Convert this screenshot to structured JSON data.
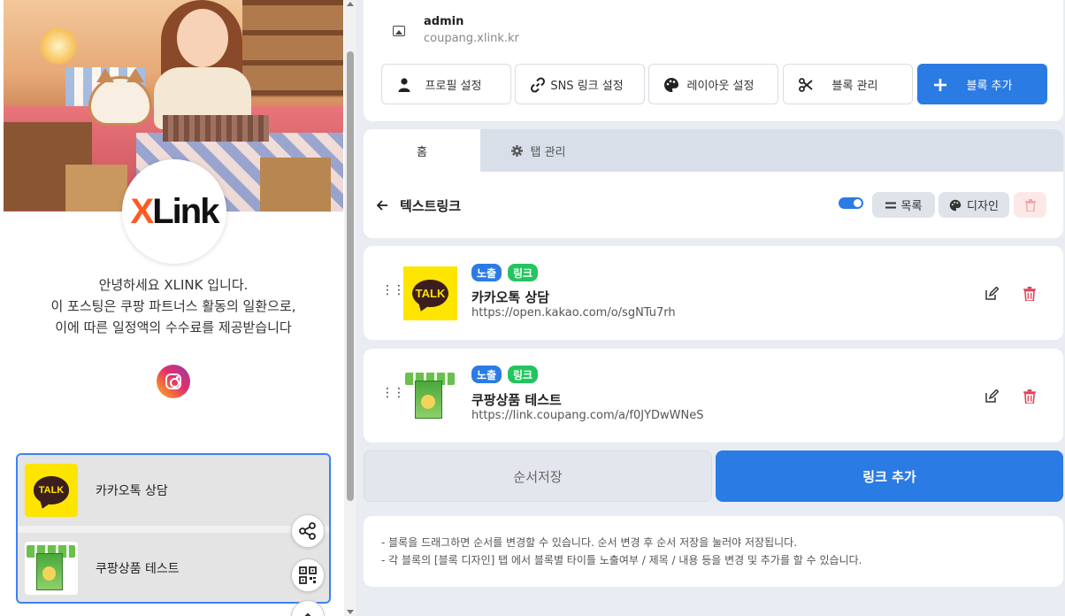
{
  "preview": {
    "logo_part1": "X",
    "logo_part2": "Link",
    "intro_lines": [
      "안녕하세요 XLINK 입니다.",
      "이 포스팅은 쿠팡 파트너스 활동의 일환으로,",
      "이에 따른 일정액의 수수료를 제공받습니다"
    ],
    "social_icon": "instagram-icon",
    "items": [
      {
        "label": "카카오톡 상담",
        "icon": "kakao-talk-icon",
        "icon_text": "TALK"
      },
      {
        "label": "쿠팡상품 테스트",
        "icon": "product-image"
      }
    ]
  },
  "header": {
    "name": "admin",
    "url": "coupang.xlink.kr",
    "buttons": [
      {
        "label": "프로필 설정",
        "icon": "user-icon"
      },
      {
        "label": "SNS 링크 설정",
        "icon": "link-icon"
      },
      {
        "label": "레이아웃 설정",
        "icon": "palette-icon"
      },
      {
        "label": "블록 관리",
        "icon": "scissors-icon"
      },
      {
        "label": "블록 추가",
        "icon": "plus-icon"
      }
    ]
  },
  "tabs": [
    {
      "label": "홈",
      "active": true
    },
    {
      "label": "탭 관리",
      "icon": "gear-icon",
      "active": false
    }
  ],
  "block_editor": {
    "title": "텍스트링크",
    "toggle_on": true,
    "list_label": "목록",
    "design_label": "디자인"
  },
  "blocks": [
    {
      "badge_visible": "노출",
      "badge_type": "링크",
      "title": "카카오톡 상담",
      "url": "https://open.kakao.com/o/sgNTu7rh",
      "icon_text": "TALK"
    },
    {
      "badge_visible": "노출",
      "badge_type": "링크",
      "title": "쿠팡상품 테스트",
      "url": "https://link.coupang.com/a/f0JYDwWNeS"
    }
  ],
  "actions": {
    "save_order": "순서저장",
    "add_link": "링크 추가"
  },
  "notes": [
    "- 블록을 드래그하면 순서를 변경할 수 있습니다. 순서 변경 후 순서 저장을 눌러야 저장됩니다.",
    "- 각 블록의 [블록 디자인] 탭 에서 블록별 타이틀 노출여부 / 제목 / 내용 등을 변경 및 추가를 할 수 있습니다."
  ],
  "colors": {
    "primary": "#2b7be4",
    "badge_green": "#22c55e",
    "danger": "#e0445a",
    "kakao_yellow": "#fee500",
    "logo_orange": "#ff5a1f"
  }
}
